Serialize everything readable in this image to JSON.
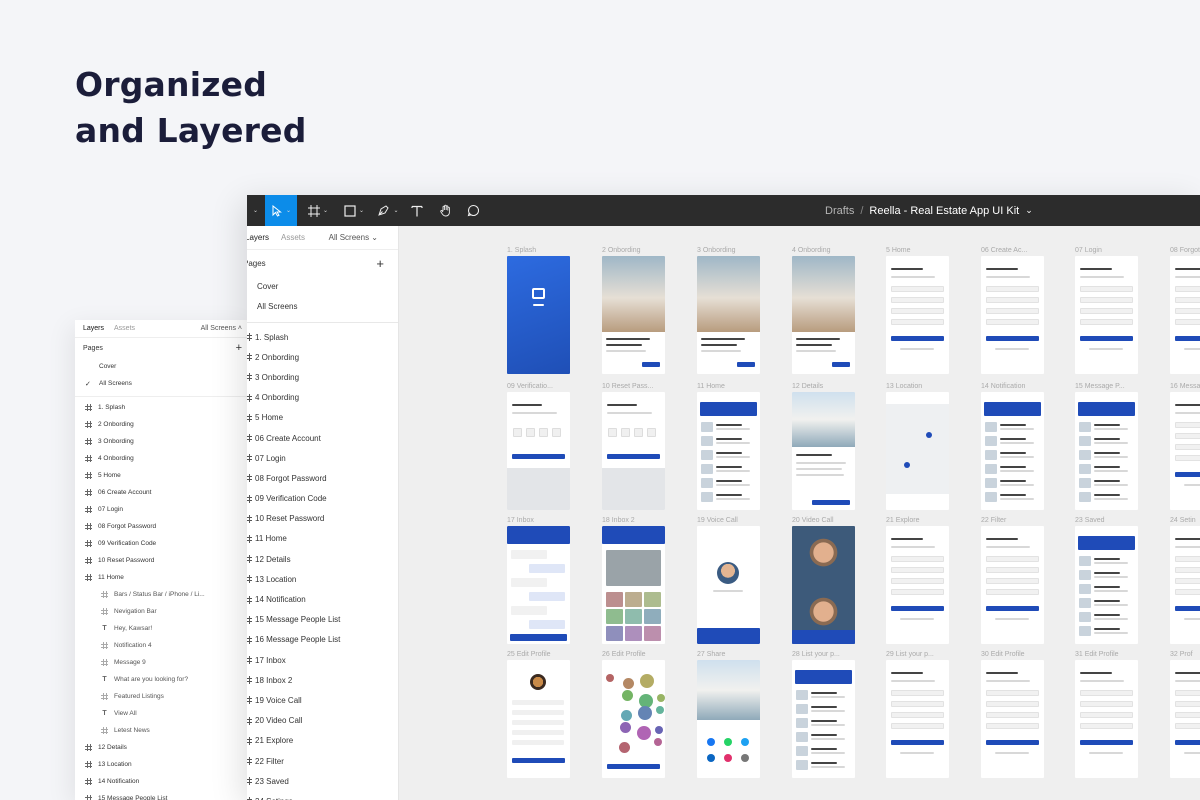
{
  "headline": {
    "line1": "Organized",
    "line2": "and Layered"
  },
  "back_panel": {
    "tabs": {
      "layers": "Layers",
      "assets": "Assets",
      "all_screens": "All Screens ˄"
    },
    "pages_label": "Pages",
    "pages": [
      "Cover",
      "All Screens"
    ],
    "layers": [
      {
        "label": "1. Splash",
        "type": "frame"
      },
      {
        "label": "2 Onbording",
        "type": "frame"
      },
      {
        "label": "3 Onbording",
        "type": "frame"
      },
      {
        "label": "4 Onbording",
        "type": "frame"
      },
      {
        "label": "5 Home",
        "type": "frame"
      },
      {
        "label": "06 Create Account",
        "type": "frame"
      },
      {
        "label": "07 Login",
        "type": "frame"
      },
      {
        "label": "08 Forgot Password",
        "type": "frame"
      },
      {
        "label": "09 Verification Code",
        "type": "frame"
      },
      {
        "label": "10 Reset Password",
        "type": "frame"
      },
      {
        "label": "11 Home",
        "type": "frame"
      },
      {
        "label": "Bars / Status Bar / iPhone / Li...",
        "type": "sub-grid"
      },
      {
        "label": "Nevigation Bar",
        "type": "sub"
      },
      {
        "label": "Hey, Kawsar!",
        "type": "sub-text"
      },
      {
        "label": "Notification 4",
        "type": "sub"
      },
      {
        "label": "Message 9",
        "type": "sub"
      },
      {
        "label": "What are you looking for?",
        "type": "sub-text"
      },
      {
        "label": "Featured Listings",
        "type": "sub"
      },
      {
        "label": "View All",
        "type": "sub-text"
      },
      {
        "label": "Letest News",
        "type": "sub"
      },
      {
        "label": "12 Details",
        "type": "frame"
      },
      {
        "label": "13 Location",
        "type": "frame"
      },
      {
        "label": "14 Notification",
        "type": "frame"
      },
      {
        "label": "15 Message People List",
        "type": "frame"
      }
    ]
  },
  "toolbar": {
    "breadcrumb_root": "Drafts",
    "breadcrumb_sep": "/",
    "file_name": "Reella - Real Estate App UI Kit",
    "file_caret": "⌄"
  },
  "sidebar": {
    "tabs": {
      "layers": "Layers",
      "assets": "Assets",
      "all_screens": "All Screens ⌄"
    },
    "pages_label": "Pages",
    "pages": [
      "Cover",
      "All Screens"
    ],
    "layers": [
      "1. Splash",
      "2 Onbording",
      "3 Onbording",
      "4 Onbording",
      "5 Home",
      "06 Create Account",
      "07 Login",
      "08 Forgot Password",
      "09 Verification Code",
      "10 Reset Password",
      "11 Home",
      "12 Details",
      "13 Location",
      "14 Notification",
      "15 Message People List",
      "16 Message People List",
      "17 Inbox",
      "18 Inbox 2",
      "19 Voice Call",
      "20 Video Call",
      "21 Explore",
      "22 Filter",
      "23 Saved",
      "24 Setings"
    ]
  },
  "canvas": {
    "frames": [
      {
        "label": "1. Splash",
        "style": "splash"
      },
      {
        "label": "2 Onbording",
        "style": "onboard"
      },
      {
        "label": "3 Onbording",
        "style": "onboard"
      },
      {
        "label": "4 Onbording",
        "style": "onboard"
      },
      {
        "label": "5 Home",
        "style": "form"
      },
      {
        "label": "06 Create Ac...",
        "style": "form"
      },
      {
        "label": "07 Login",
        "style": "form"
      },
      {
        "label": "08 Forgot",
        "style": "form"
      },
      {
        "label": "09 Verificatio...",
        "style": "keypad"
      },
      {
        "label": "10 Reset Pass...",
        "style": "keypad"
      },
      {
        "label": "11 Home",
        "style": "list"
      },
      {
        "label": "12 Details",
        "style": "details"
      },
      {
        "label": "13 Location",
        "style": "map"
      },
      {
        "label": "14 Notification",
        "style": "list"
      },
      {
        "label": "15 Message P...",
        "style": "list"
      },
      {
        "label": "16 Messa",
        "style": "form"
      },
      {
        "label": "17 Inbox",
        "style": "chat"
      },
      {
        "label": "18 Inbox 2",
        "style": "gallery"
      },
      {
        "label": "19 Voice Call",
        "style": "call"
      },
      {
        "label": "20 Video Call",
        "style": "video"
      },
      {
        "label": "21 Explore",
        "style": "form"
      },
      {
        "label": "22 Filter",
        "style": "form"
      },
      {
        "label": "23 Saved",
        "style": "list"
      },
      {
        "label": "24 Setin",
        "style": "form"
      },
      {
        "label": "25 Edit Profile",
        "style": "profile"
      },
      {
        "label": "26 Edit Profile",
        "style": "bubbles"
      },
      {
        "label": "27 Share",
        "style": "share"
      },
      {
        "label": "28 List your p...",
        "style": "list"
      },
      {
        "label": "29 List your p...",
        "style": "form"
      },
      {
        "label": "30 Edit Profile",
        "style": "form"
      },
      {
        "label": "31 Edit Profile",
        "style": "form"
      },
      {
        "label": "32 Prof",
        "style": "form"
      }
    ]
  },
  "colors": {
    "brand_blue": "#1f4bb8",
    "toolbar_bg": "#2c2c2c",
    "active_tool": "#0c8ce9",
    "headline": "#1b1d3a"
  },
  "tools": [
    "move-icon",
    "frame-icon",
    "rectangle-icon",
    "pen-icon",
    "text-icon",
    "hand-icon",
    "comment-icon"
  ]
}
